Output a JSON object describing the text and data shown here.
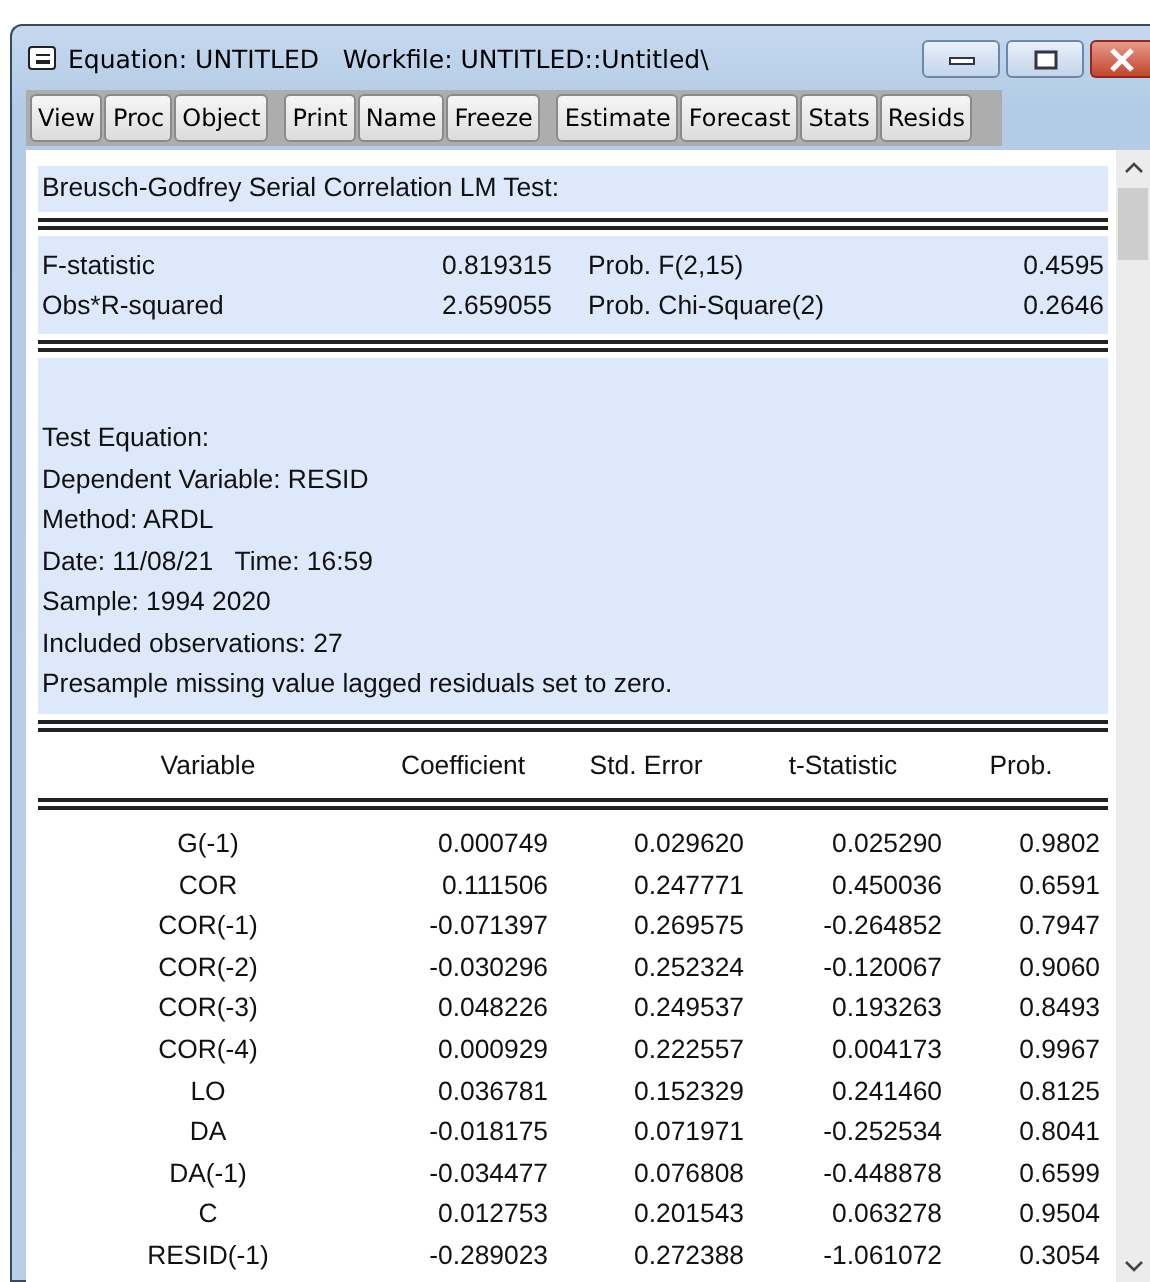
{
  "window": {
    "title": "Equation: UNTITLED   Workfile: UNTITLED::Untitled\\"
  },
  "toolbar": {
    "groups": [
      [
        "View",
        "Proc",
        "Object"
      ],
      [
        "Print",
        "Name",
        "Freeze"
      ],
      [
        "Estimate",
        "Forecast",
        "Stats",
        "Resids"
      ]
    ]
  },
  "output": {
    "test_title": "Breusch-Godfrey Serial Correlation LM Test:",
    "statistics": [
      {
        "label": "F-statistic",
        "value": "0.819315",
        "prob_label": "Prob. F(2,15)",
        "prob": "0.4595"
      },
      {
        "label": "Obs*R-squared",
        "value": "2.659055",
        "prob_label": "Prob. Chi-Square(2)",
        "prob": "0.2646"
      }
    ],
    "info_lines": [
      "Test Equation:",
      "Dependent Variable: RESID",
      "Method: ARDL",
      "Date: 11/08/21   Time: 16:59",
      "Sample: 1994 2020",
      "Included observations: 27",
      "Presample missing value lagged residuals set to zero."
    ],
    "table": {
      "columns": [
        "Variable",
        "Coefficient",
        "Std. Error",
        "t-Statistic",
        "Prob."
      ],
      "rows": [
        [
          "G(-1)",
          "0.000749",
          "0.029620",
          "0.025290",
          "0.9802"
        ],
        [
          "COR",
          "0.111506",
          "0.247771",
          "0.450036",
          "0.6591"
        ],
        [
          "COR(-1)",
          "-0.071397",
          "0.269575",
          "-0.264852",
          "0.7947"
        ],
        [
          "COR(-2)",
          "-0.030296",
          "0.252324",
          "-0.120067",
          "0.9060"
        ],
        [
          "COR(-3)",
          "0.048226",
          "0.249537",
          "0.193263",
          "0.8493"
        ],
        [
          "COR(-4)",
          "0.000929",
          "0.222557",
          "0.004173",
          "0.9967"
        ],
        [
          "LO",
          "0.036781",
          "0.152329",
          "0.241460",
          "0.8125"
        ],
        [
          "DA",
          "-0.018175",
          "0.071971",
          "-0.252534",
          "0.8041"
        ],
        [
          "DA(-1)",
          "-0.034477",
          "0.076808",
          "-0.448878",
          "0.6599"
        ],
        [
          "C",
          "0.012753",
          "0.201543",
          "0.063278",
          "0.9504"
        ],
        [
          "RESID(-1)",
          "-0.289023",
          "0.272388",
          "-1.061072",
          "0.3054"
        ]
      ]
    }
  }
}
